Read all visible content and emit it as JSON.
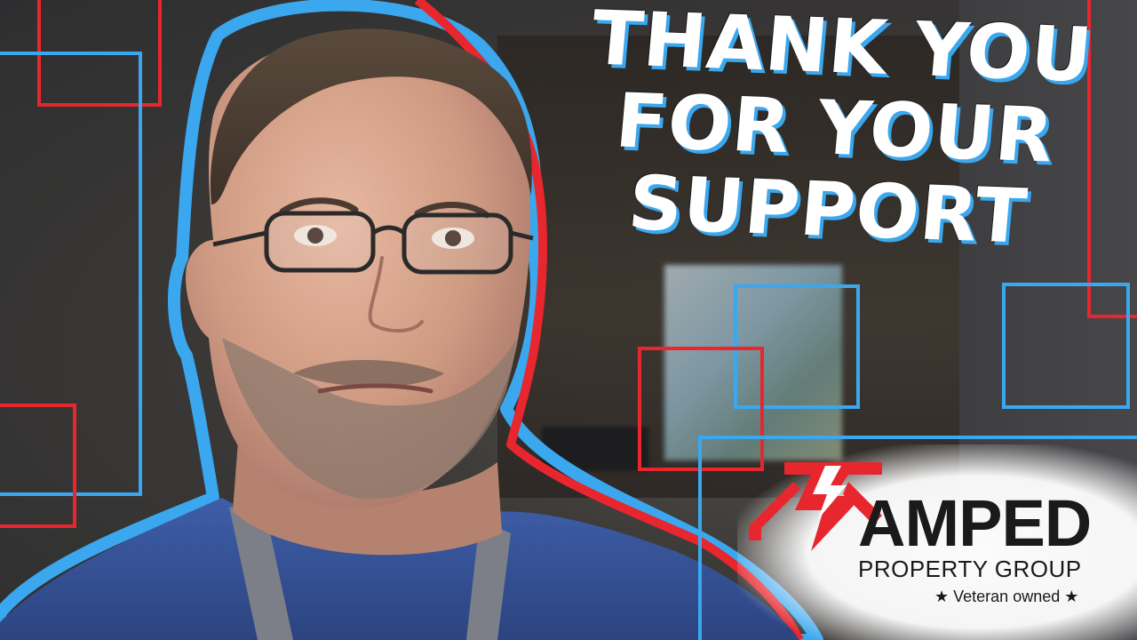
{
  "headline": {
    "line1": "THANK YOU",
    "line2": "FOR YOUR",
    "line3": "SUPPORT"
  },
  "logo": {
    "brand": "AMPED",
    "subtitle": "PROPERTY GROUP",
    "tagline": "★ Veteran owned ★",
    "mark_icon": "lightning-house-icon"
  },
  "colors": {
    "accent_red": "#e8262e",
    "accent_blue": "#3aa7ee",
    "text_dark": "#1a1a1a"
  }
}
